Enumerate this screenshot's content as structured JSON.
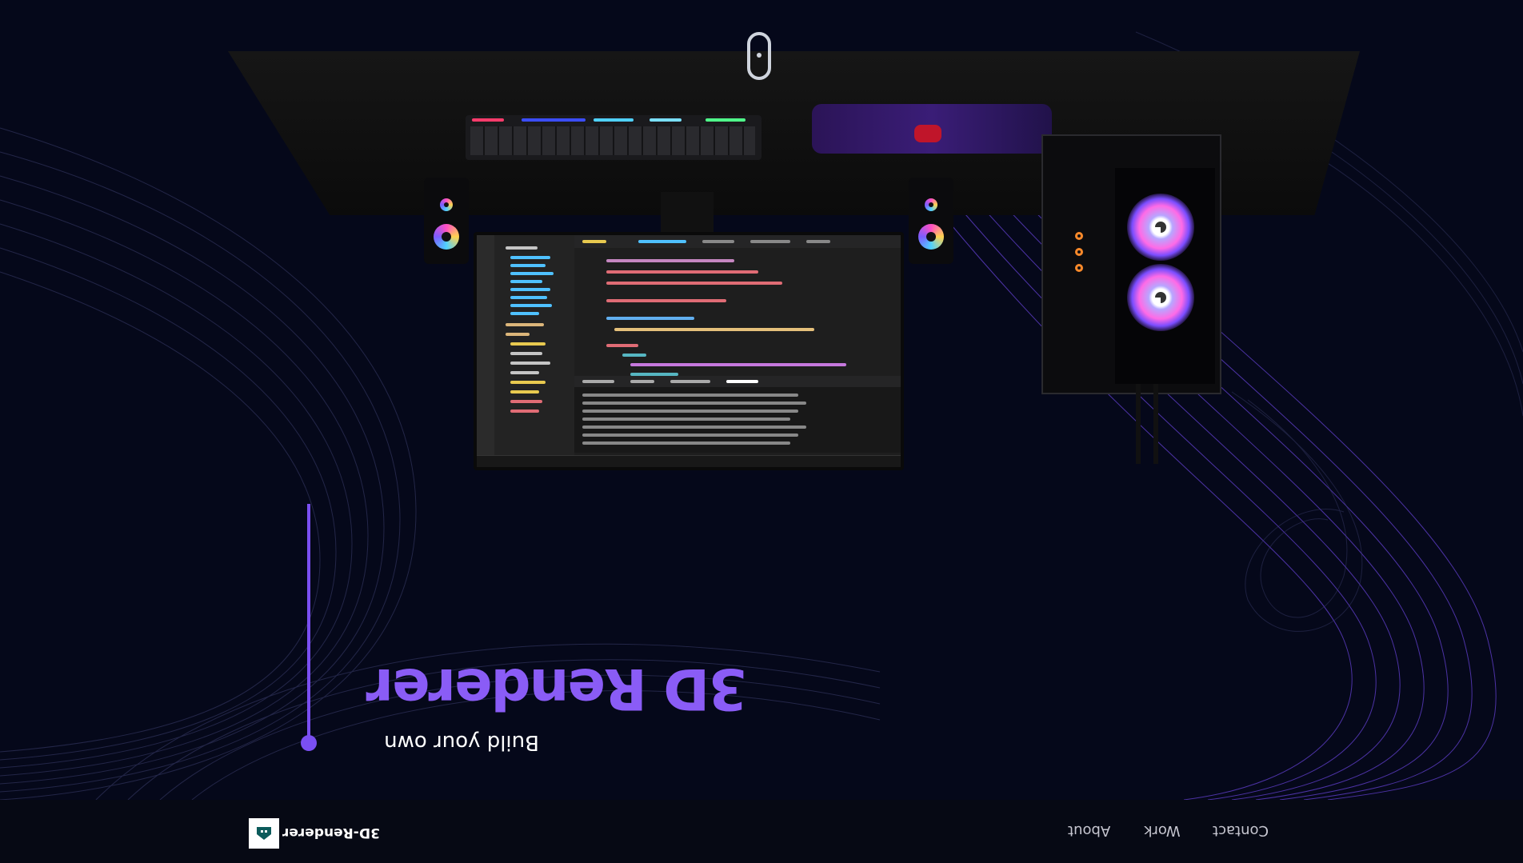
{
  "brand": {
    "name": "3D-Renderer",
    "logo_icon": "house-logo-icon"
  },
  "nav": {
    "items": [
      {
        "label": "Contact"
      },
      {
        "label": "Work"
      },
      {
        "label": "About"
      }
    ]
  },
  "hero": {
    "title": "3D Renderer",
    "subtitle": "Build your own"
  },
  "colors": {
    "accent": "#8a5cf6",
    "background": "#05081a",
    "navbar": "#060914",
    "text": "#ffffff",
    "nav_text": "#c6c6d0"
  },
  "scene": {
    "objects": [
      "desk",
      "keyboard",
      "mousepad",
      "mouse",
      "speakers",
      "monitor",
      "pc-case"
    ]
  }
}
